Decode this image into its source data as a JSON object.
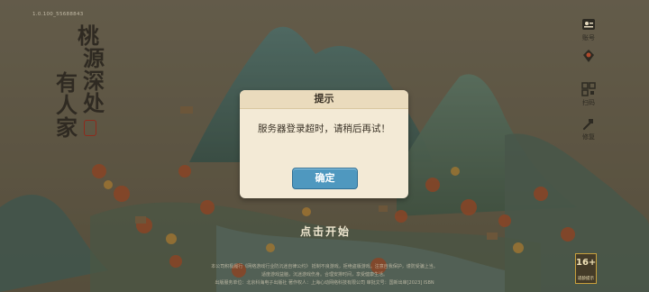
{
  "game": {
    "version_text": "1.0.100_55688843",
    "logo": {
      "chars": [
        "桃",
        "源",
        "深",
        "处",
        "有",
        "人",
        "家"
      ],
      "seal_text": ""
    },
    "side_menu": [
      {
        "label": "账号",
        "icon": "account-icon"
      },
      {
        "label": "",
        "icon": "character-icon"
      },
      {
        "label": "扫码",
        "icon": "qr-icon"
      },
      {
        "label": "修复",
        "icon": "repair-icon"
      }
    ],
    "start_text": "点击开始",
    "age_rating": {
      "number": "16+",
      "label": "适龄提示"
    },
    "legal_lines": [
      "本公司积极履行《网络游戏行业防沉迷自律公约》 抵制不良游戏，拒绝盗版游戏。注意自我保护，谨防受骗上当。",
      "适度游戏益脑，沉迷游戏伤身。合理安排时间，享受健康生活。",
      "出版服务单位：北京科海电子出版社  著作权人：上海心动网络科技有限公司  审批文号：国新出审[2023]  ISBN"
    ]
  },
  "dialog": {
    "title": "提示",
    "message": "服务器登录超时，请稍后再试！",
    "button_label": "确定"
  },
  "colors": {
    "button": "#4f98bf",
    "dialog_bg": "#f3ead6",
    "seal": "#8e2a1c"
  }
}
